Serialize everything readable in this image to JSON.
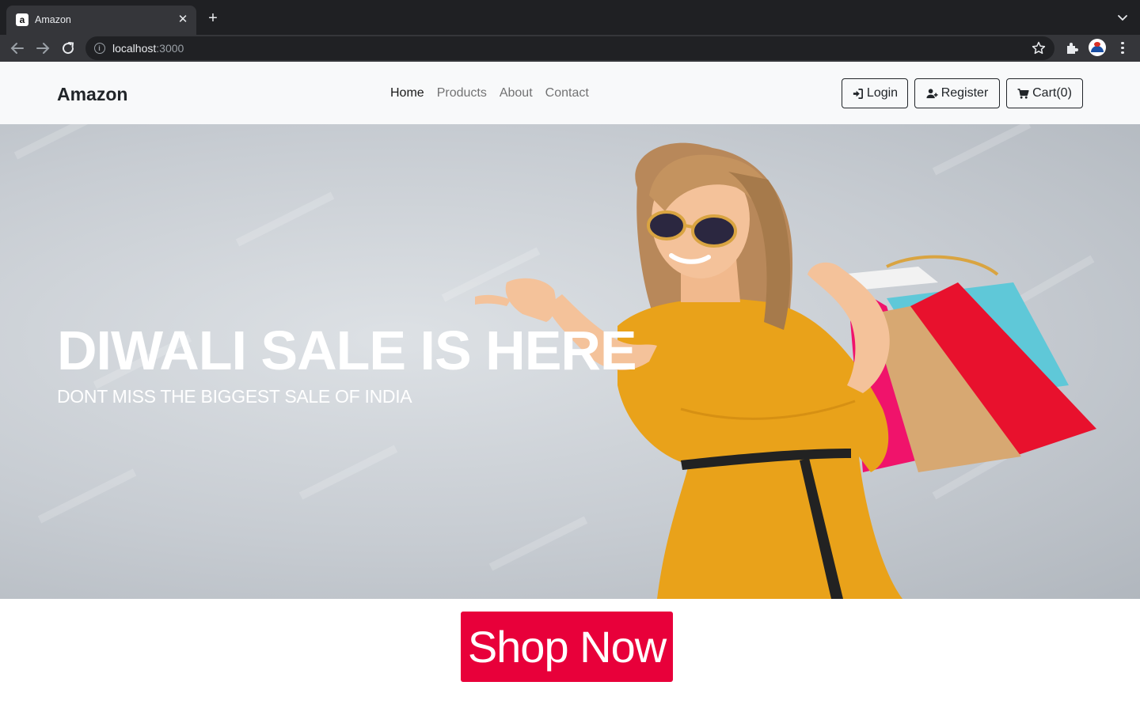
{
  "browser": {
    "tab_title": "Amazon",
    "tab_favicon_letter": "a",
    "close_glyph": "✕",
    "new_tab_glyph": "+",
    "url_host": "localhost",
    "url_port": ":3000",
    "icons": [
      "back-arrow-icon",
      "forward-arrow-icon",
      "reload-icon",
      "info-icon",
      "star-icon",
      "extensions-icon",
      "profile-avatar",
      "menu-icon",
      "tab-search-chevron-icon"
    ]
  },
  "navbar": {
    "brand": "Amazon",
    "links": [
      {
        "label": "Home",
        "active": true
      },
      {
        "label": "Products",
        "active": false
      },
      {
        "label": "About",
        "active": false
      },
      {
        "label": "Contact",
        "active": false
      }
    ],
    "buttons": {
      "login": "Login",
      "register": "Register",
      "cart": "Cart(0)"
    }
  },
  "hero": {
    "title": "DIWALI SALE IS HERE",
    "subtitle": "DONT MISS THE BIGGEST SALE OF INDIA",
    "image_subject": "smiling woman in mustard dress and sunglasses holding shopping bags",
    "watermark": "Adobe Stock"
  },
  "cta": {
    "label": "Shop Now",
    "color": "#e8003a"
  },
  "colors": {
    "navbar_bg": "#f8f9fa",
    "chrome_dark": "#1f2023",
    "dress": "#e9a21a",
    "bag_red": "#e8112d"
  }
}
